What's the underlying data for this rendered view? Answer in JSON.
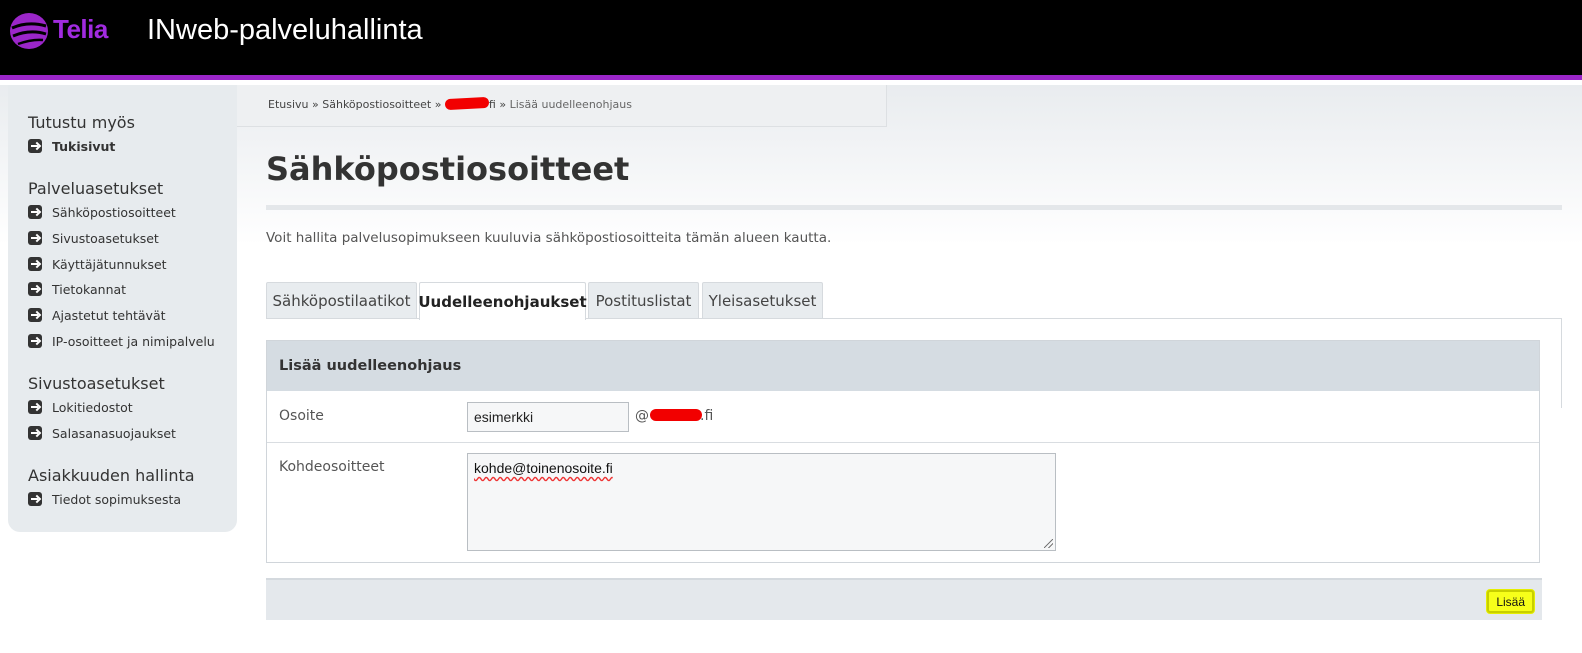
{
  "header": {
    "logo_text": "Telia",
    "app_title": "INweb-palveluhallinta"
  },
  "sidebar": {
    "sections": [
      {
        "heading": "Tutustu myös",
        "items": [
          "Tukisivut"
        ]
      },
      {
        "heading": "Palveluasetukset",
        "items": [
          "Sähköpostiosoitteet",
          "Sivustoasetukset",
          "Käyttäjätunnukset",
          "Tietokannat",
          "Ajastetut tehtävät",
          "IP-osoitteet ja nimipalvelu"
        ]
      },
      {
        "heading": "Sivustoasetukset",
        "items": [
          "Lokitiedostot",
          "Salasanasuojaukset"
        ]
      },
      {
        "heading": "Asiakkuuden hallinta",
        "items": [
          "Tiedot sopimuksesta"
        ]
      }
    ]
  },
  "breadcrumb": {
    "home": "Etusivu",
    "sep": "»",
    "section": "Sähköpostiosoitteet",
    "domain_suffix": "fi",
    "current": "Lisää uudelleenohjaus"
  },
  "page": {
    "title": "Sähköpostiosoitteet",
    "intro": "Voit hallita palvelusopimukseen kuuluvia sähköpostiosoitteita tämän alueen kautta."
  },
  "tabs": [
    {
      "label": "Sähköpostilaatikot",
      "active": false
    },
    {
      "label": "Uudelleenohjaukset",
      "active": true
    },
    {
      "label": "Postituslistat",
      "active": false
    },
    {
      "label": "Yleisasetukset",
      "active": false
    }
  ],
  "form": {
    "heading": "Lisää uudelleenohjaus",
    "address_label": "Osoite",
    "address_value": "esimerkki",
    "at_sign": "@",
    "domain_suffix": ".fi",
    "targets_label": "Kohdeosoitteet",
    "targets_value": "kohde@toinenosoite.fi",
    "submit_label": "Lisää"
  },
  "colors": {
    "header_bg": "#000000",
    "accent": "#9b26c9",
    "sidebar_bg": "#e7ebee",
    "highlight": "#f7ff1a",
    "redaction": "#f20000"
  }
}
